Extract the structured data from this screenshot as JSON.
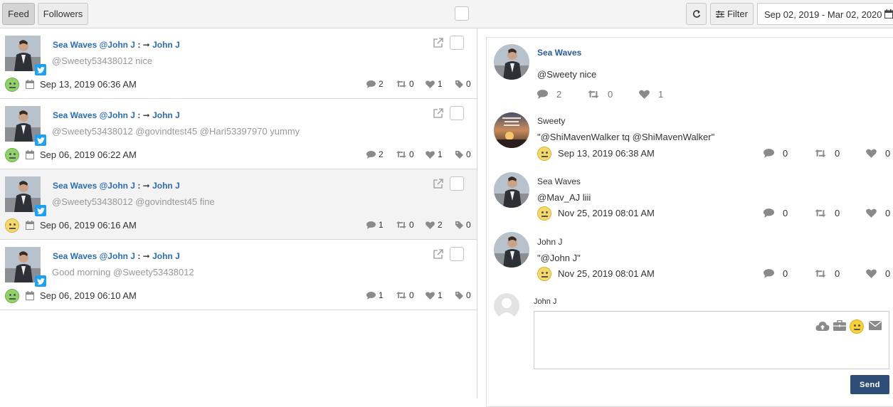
{
  "toolbar": {
    "tabs": [
      {
        "label": "Feed",
        "active": true
      },
      {
        "label": "Followers",
        "active": false
      }
    ],
    "refresh_icon": "refresh-icon",
    "filter_label": "Filter",
    "date_range": "Sep 02, 2019 - Mar 02, 2020"
  },
  "feed": {
    "posts": [
      {
        "account": "Sea Waves",
        "handle": "@John J",
        "sep": ":",
        "arrow": "➞",
        "recipient": "John J",
        "text": "@Sweety53438012 nice",
        "sentiment": "positive",
        "date": "Sep 13, 2019 06:36 AM",
        "comments": "2",
        "retweets": "0",
        "likes": "1",
        "tags": "0",
        "highlighted": false
      },
      {
        "account": "Sea Waves",
        "handle": "@John J",
        "sep": ":",
        "arrow": "➞",
        "recipient": "John J",
        "text": "@Sweety53438012 @govindtest45 @Hari53397970 yummy",
        "sentiment": "positive",
        "date": "Sep 06, 2019 06:22 AM",
        "comments": "2",
        "retweets": "0",
        "likes": "1",
        "tags": "0",
        "highlighted": false
      },
      {
        "account": "Sea Waves",
        "handle": "@John J",
        "sep": ":",
        "arrow": "➞",
        "recipient": "John J",
        "text": "@Sweety53438012 @govindtest45 fine",
        "sentiment": "neutral",
        "date": "Sep 06, 2019 06:16 AM",
        "comments": "1",
        "retweets": "0",
        "likes": "2",
        "tags": "0",
        "highlighted": true
      },
      {
        "account": "Sea Waves",
        "handle": "@John J",
        "sep": ":",
        "arrow": "➞",
        "recipient": "John J",
        "text": "Good morning @Sweety53438012",
        "sentiment": "positive",
        "date": "Sep 06, 2019 06:10 AM",
        "comments": "1",
        "retweets": "0",
        "likes": "1",
        "tags": "0",
        "highlighted": false
      }
    ]
  },
  "detail": {
    "main": {
      "account": "Sea Waves",
      "text": "@Sweety nice",
      "comments": "2",
      "retweets": "0",
      "likes": "1"
    },
    "replies": [
      {
        "name": "Sweety",
        "text": "\"@ShiMavenWalker tq @ShiMavenWalker\"",
        "date": "Sep 13, 2019 06:38 AM",
        "comments": "0",
        "retweets": "0",
        "likes": "0"
      },
      {
        "name": "Sea Waves",
        "text": "@Mav_AJ liii",
        "date": "Nov 25, 2019 08:01 AM",
        "comments": "0",
        "retweets": "0",
        "likes": "0"
      },
      {
        "name": "John J",
        "text": "\"@John J\"",
        "date": "Nov 25, 2019 08:01 AM",
        "comments": "0",
        "retweets": "0",
        "likes": "0"
      }
    ],
    "composer": {
      "user": "John J",
      "placeholder": "",
      "send_label": "Send"
    }
  },
  "colors": {
    "link": "#2a6db5",
    "twitter": "#1da1f2",
    "send": "#2e4e78"
  }
}
